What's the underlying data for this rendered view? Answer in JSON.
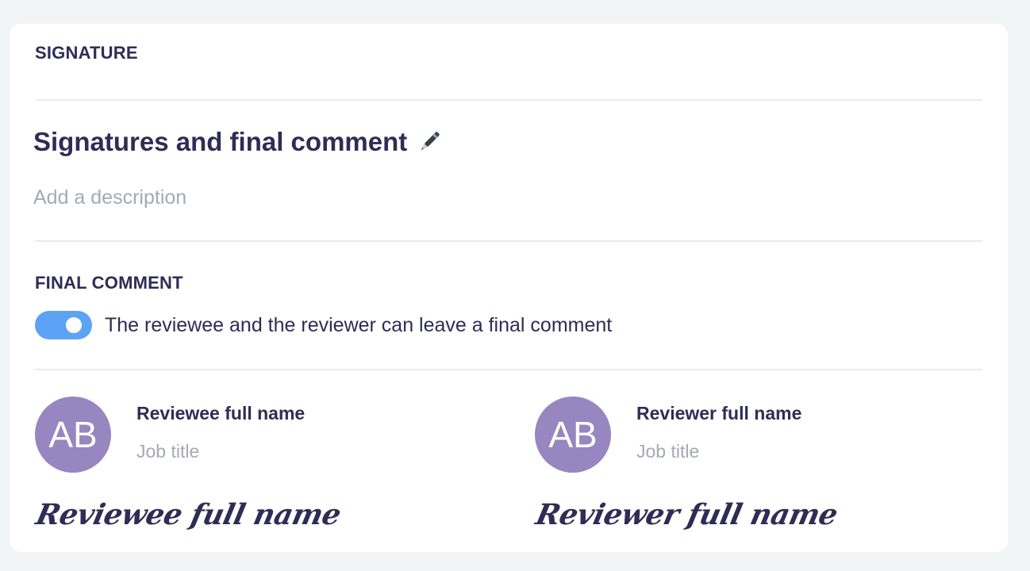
{
  "signature_section": {
    "label": "SIGNATURE",
    "title": "Signatures and final comment",
    "title_icon": "pen-icon",
    "description_placeholder": "Add a description"
  },
  "final_comment": {
    "label": "FINAL COMMENT",
    "toggle_on": true,
    "toggle_text": "The reviewee and the reviewer can leave a final comment"
  },
  "people": [
    {
      "avatar_initials": "AB",
      "name": "Reviewee full name",
      "job_title": "Job title",
      "signature": "Reviewee full name"
    },
    {
      "avatar_initials": "AB",
      "name": "Reviewer full name",
      "job_title": "Job title",
      "signature": "Reviewer full name"
    }
  ],
  "colors": {
    "toggle_accent": "#5da3f5",
    "avatar_bg": "#9786c0",
    "text_primary": "#2f2c55",
    "text_muted": "#a5a9b5"
  }
}
